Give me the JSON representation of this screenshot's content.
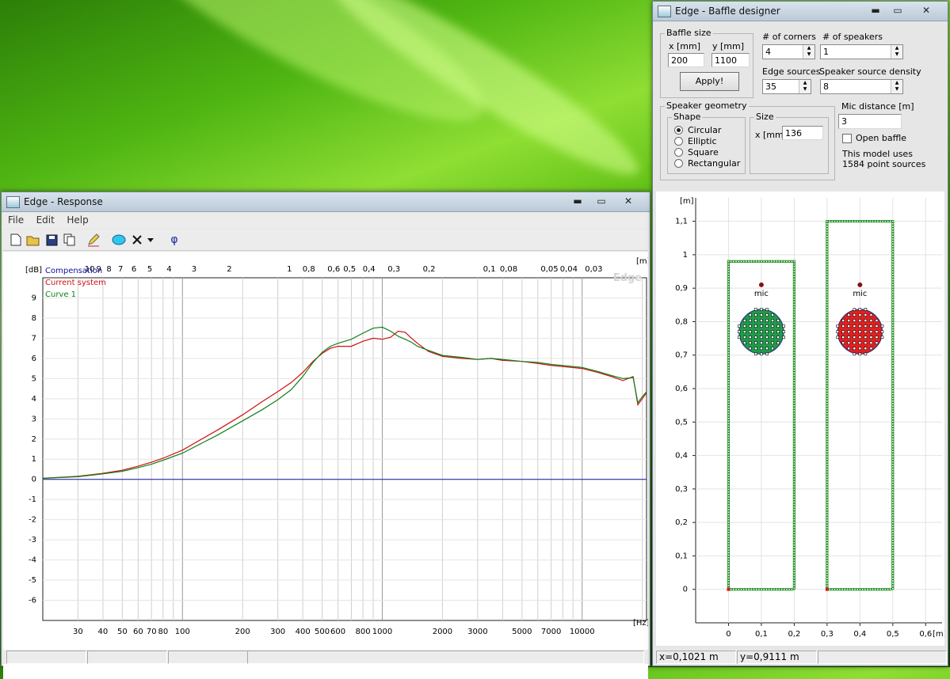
{
  "response_window": {
    "title": "Edge - Response",
    "buttons": {
      "minimize": "▬",
      "maximize": "▭",
      "close": "✕"
    },
    "menu": [
      "File",
      "Edit",
      "Help"
    ],
    "toolbar_phi": "φ",
    "watermark": "Edge",
    "legend": [
      "Compensation",
      "Current system",
      "Curve 1"
    ],
    "unit_db": "[dB]",
    "unit_hz": "[Hz]",
    "unit_m": "[m]"
  },
  "baffle_window": {
    "title": "Edge - Baffle designer",
    "buttons": {
      "minimize": "▬",
      "maximize": "▭",
      "close": "✕"
    },
    "baffle_size_label": "Baffle size",
    "x_label": "x [mm]",
    "y_label": "y [mm]",
    "x_value": "200",
    "y_value": "1100",
    "apply_label": "Apply!",
    "corners_label": "# of corners",
    "corners_value": "4",
    "speakers_label": "# of speakers",
    "speakers_value": "1",
    "edge_sources_label": "Edge sources",
    "edge_sources_value": "35",
    "density_label": "Speaker source density",
    "density_value": "8",
    "geometry_label": "Speaker geometry",
    "shape_label": "Shape",
    "shapes": [
      "Circular",
      "Elliptic",
      "Square",
      "Rectangular"
    ],
    "selected_shape": "Circular",
    "size_label": "Size",
    "size_x_label": "x [mm]",
    "size_x_value": "136",
    "mic_distance_label": "Mic distance [m]",
    "mic_distance_value": "3",
    "open_baffle_label": "Open baffle",
    "open_baffle_checked": false,
    "model_info_line1": "This model uses",
    "model_info_line2": "1584 point sources",
    "plot_unit": "[m]",
    "mic_label": "mic",
    "status_x": "x=0,1021 m",
    "status_y": "y=0,9111 m"
  },
  "chart_data": [
    {
      "type": "line",
      "title": "",
      "xlabel": "[Hz]",
      "ylabel": "[dB]",
      "x_scale": "log",
      "xlim": [
        20,
        21000
      ],
      "ylim": [
        -7,
        10
      ],
      "grid": true,
      "legend_placement": "top-left",
      "x_tick_labels": [
        "30",
        "40",
        "50",
        "60",
        "70",
        "80",
        "100",
        "200",
        "300",
        "400",
        "500",
        "600",
        "800",
        "1000",
        "2000",
        "3000",
        "5000",
        "7000",
        "10000"
      ],
      "y_tick_labels": [
        "9",
        "8",
        "7",
        "6",
        "5",
        "4",
        "3",
        "2",
        "1",
        "0",
        "-1",
        "-2",
        "-3",
        "-4",
        "-5",
        "-6"
      ],
      "top_axis_label": "[m]",
      "top_axis_tick_labels": [
        "10",
        "9",
        "8",
        "7",
        "6",
        "5",
        "4",
        "3",
        "2",
        "1",
        "0,8",
        "0,6",
        "0,5",
        "0,4",
        "0,3",
        "0,2",
        "0,1",
        "0,08",
        "0,05",
        "0,04",
        "0,03"
      ],
      "series": [
        {
          "name": "Compensation",
          "color": "#1010a0",
          "x": [
            20,
            21000
          ],
          "y": [
            0,
            0
          ]
        },
        {
          "name": "Current system",
          "color": "#d01010",
          "x": [
            20,
            30,
            40,
            50,
            60,
            70,
            80,
            100,
            150,
            200,
            250,
            300,
            350,
            400,
            450,
            500,
            550,
            600,
            700,
            800,
            900,
            1000,
            1100,
            1200,
            1300,
            1400,
            1500,
            1700,
            2000,
            2500,
            3000,
            3500,
            4000,
            5000,
            6000,
            7000,
            8000,
            10000,
            12000,
            14000,
            16000,
            18000,
            19000,
            20000,
            21000
          ],
          "y": [
            0.05,
            0.15,
            0.3,
            0.45,
            0.65,
            0.85,
            1.05,
            1.45,
            2.45,
            3.2,
            3.85,
            4.35,
            4.8,
            5.3,
            5.85,
            6.25,
            6.5,
            6.6,
            6.6,
            6.85,
            7.0,
            6.95,
            7.05,
            7.35,
            7.3,
            7.0,
            6.75,
            6.35,
            6.1,
            6.0,
            5.95,
            6.0,
            5.9,
            5.85,
            5.75,
            5.65,
            5.6,
            5.5,
            5.3,
            5.1,
            4.9,
            5.1,
            3.7,
            4.0,
            4.3
          ]
        },
        {
          "name": "Curve 1",
          "color": "#10801a",
          "x": [
            20,
            30,
            40,
            50,
            60,
            70,
            80,
            100,
            150,
            200,
            250,
            300,
            350,
            400,
            450,
            500,
            550,
            600,
            700,
            800,
            900,
            1000,
            1100,
            1200,
            1300,
            1400,
            1500,
            1700,
            2000,
            2500,
            3000,
            3500,
            4000,
            5000,
            6000,
            7000,
            8000,
            10000,
            12000,
            14000,
            16000,
            18000,
            19000,
            20000,
            21000
          ],
          "y": [
            0.05,
            0.13,
            0.27,
            0.4,
            0.58,
            0.75,
            0.95,
            1.3,
            2.2,
            2.9,
            3.45,
            3.95,
            4.45,
            5.1,
            5.8,
            6.3,
            6.6,
            6.75,
            6.95,
            7.25,
            7.5,
            7.55,
            7.35,
            7.1,
            6.95,
            6.8,
            6.6,
            6.4,
            6.15,
            6.05,
            5.95,
            6.0,
            5.95,
            5.85,
            5.8,
            5.7,
            5.65,
            5.55,
            5.35,
            5.15,
            5.0,
            5.05,
            3.8,
            4.1,
            4.35
          ]
        }
      ]
    },
    {
      "type": "scatter",
      "title": "",
      "xlabel": "",
      "ylabel": "[m]",
      "xlim": [
        -0.1,
        0.65
      ],
      "ylim": [
        -0.1,
        1.17
      ],
      "grid": true,
      "x_tick_labels": [
        "0",
        "0,1",
        "0,2",
        "0,3",
        "0,4",
        "0,5",
        "0,6"
      ],
      "x_axis_unit": "[m]",
      "y_tick_labels": [
        "1,1",
        "1",
        "0,9",
        "0,8",
        "0,7",
        "0,6",
        "0,5",
        "0,4",
        "0,3",
        "0,2",
        "0,1",
        "0"
      ],
      "baffles": [
        {
          "x": [
            0,
            0.2
          ],
          "y": [
            0,
            0.98
          ],
          "speaker_color": "#1f9a4a",
          "speaker_center": [
            0.1,
            0.77
          ],
          "speaker_radius": 0.068,
          "mic": [
            0.1,
            0.91
          ]
        },
        {
          "x": [
            0.3,
            0.5
          ],
          "y": [
            0,
            1.1
          ],
          "speaker_color": "#e02020",
          "speaker_center": [
            0.4,
            0.77
          ],
          "speaker_radius": 0.068,
          "mic": [
            0.4,
            0.91
          ]
        }
      ],
      "edge_color": "#1a8a1a"
    }
  ]
}
